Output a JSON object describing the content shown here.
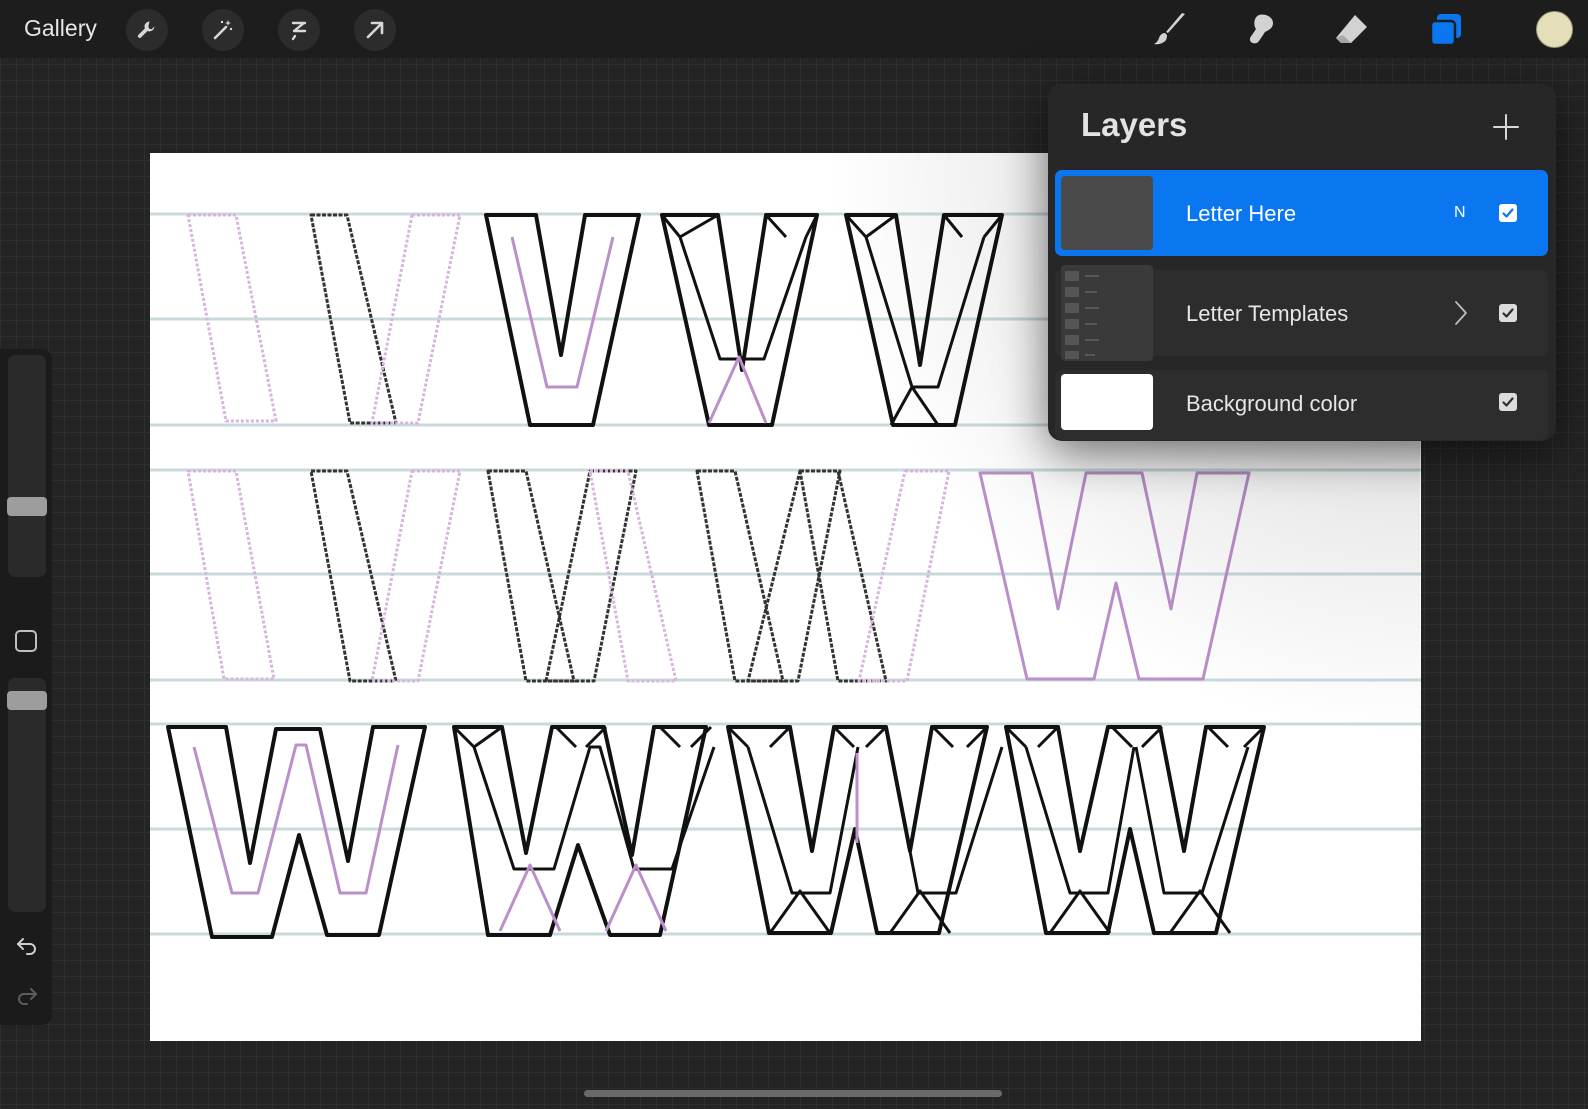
{
  "topbar": {
    "gallery_label": "Gallery",
    "left_tools": [
      "wrench-icon",
      "magic-wand-icon",
      "selection-icon",
      "transform-arrow-icon"
    ],
    "right_tools": [
      "brush-icon",
      "smudge-icon",
      "eraser-icon",
      "layers-icon"
    ],
    "active_tool": "layers-icon",
    "current_color": "#e4dfb8"
  },
  "sidebar": {
    "brush_size_level": 0.68,
    "opacity_level": 0.9,
    "icons": [
      "modify-square-icon",
      "undo-icon",
      "redo-icon"
    ]
  },
  "layers": {
    "title": "Layers",
    "add_icon": "plus-icon",
    "items": [
      {
        "name": "Letter Here",
        "blend_mode": "N",
        "visible": true,
        "active": true
      },
      {
        "name": "Letter Templates",
        "is_group": true,
        "visible": true,
        "active": false
      },
      {
        "name": "Background color",
        "visible": true,
        "active": false
      }
    ]
  },
  "colors": {
    "accent": "#0a76f0",
    "guide_lines": "#c9dadd",
    "template_stroke": "#bb8fc9",
    "ink": "#111111"
  }
}
